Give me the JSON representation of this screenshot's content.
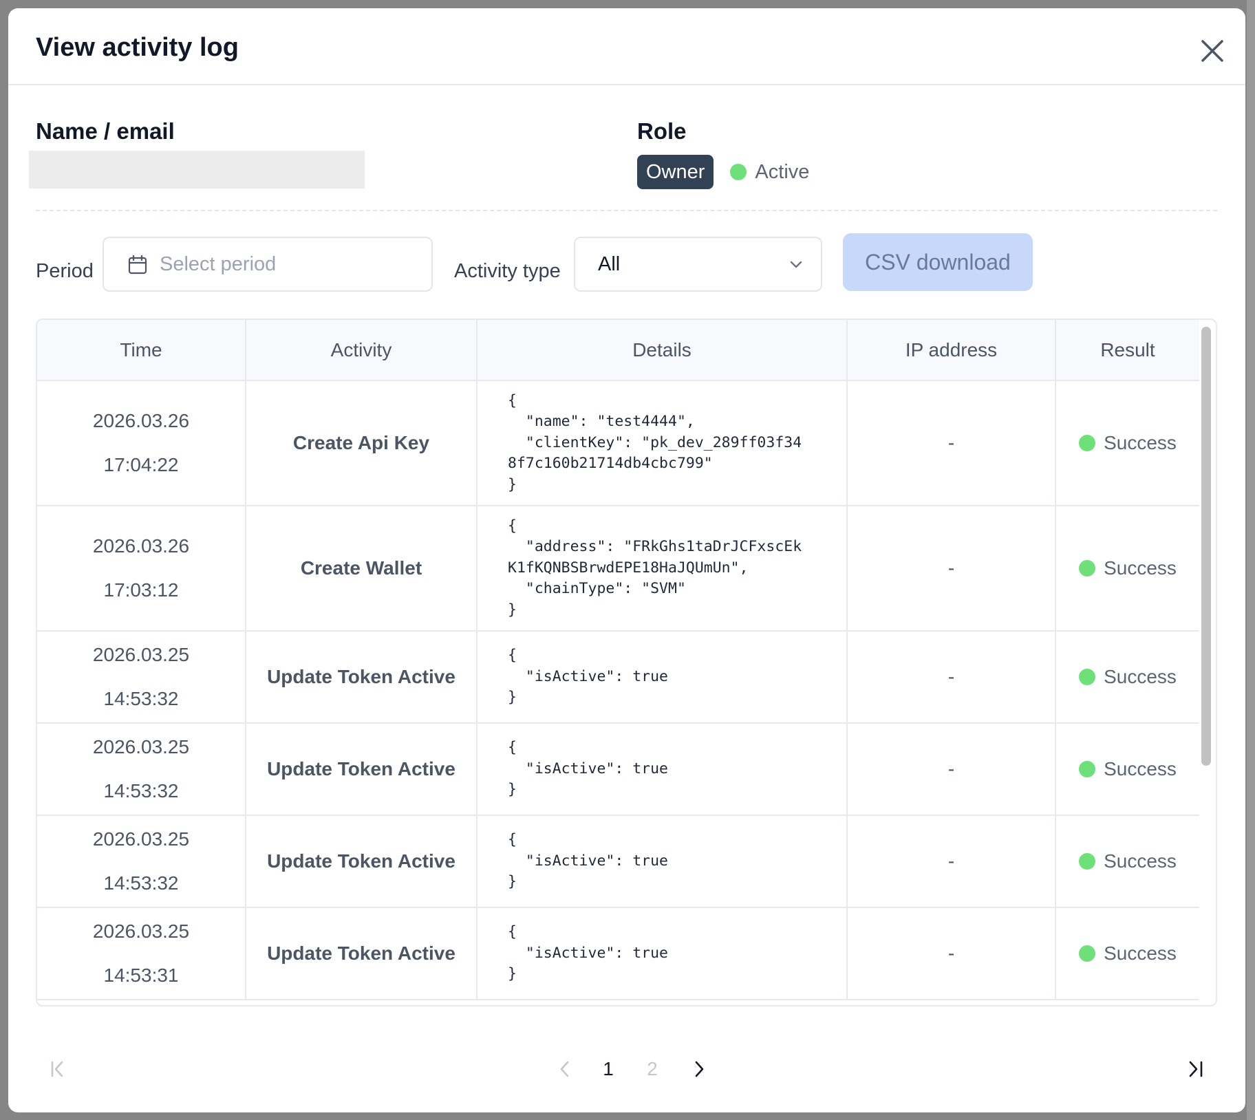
{
  "modal": {
    "title": "View activity log"
  },
  "user": {
    "name_label": "Name / email",
    "role_label": "Role",
    "role": "Owner",
    "status": "Active"
  },
  "filters": {
    "period_label": "Period",
    "period_placeholder": "Select period",
    "activity_type_label": "Activity type",
    "activity_type_value": "All",
    "csv_button": "CSV download"
  },
  "table": {
    "columns": [
      "Time",
      "Activity",
      "Details",
      "IP address",
      "Result"
    ],
    "rows": [
      {
        "date": "2026.03.26",
        "time": "17:04:22",
        "activity": "Create Api Key",
        "details": "{\n  \"name\": \"test4444\",\n  \"clientKey\": \"pk_dev_289ff03f34\n8f7c160b21714db4cbc799\"\n}",
        "ip": "-",
        "result": "Success"
      },
      {
        "date": "2026.03.26",
        "time": "17:03:12",
        "activity": "Create Wallet",
        "details": "{\n  \"address\": \"FRkGhs1taDrJCFxscEk\nK1fKQNBSBrwdEPE18HaJQUmUn\",\n  \"chainType\": \"SVM\"\n}",
        "ip": "-",
        "result": "Success"
      },
      {
        "date": "2026.03.25",
        "time": "14:53:32",
        "activity": "Update Token Active",
        "details": "{\n  \"isActive\": true\n}",
        "ip": "-",
        "result": "Success"
      },
      {
        "date": "2026.03.25",
        "time": "14:53:32",
        "activity": "Update Token Active",
        "details": "{\n  \"isActive\": true\n}",
        "ip": "-",
        "result": "Success"
      },
      {
        "date": "2026.03.25",
        "time": "14:53:32",
        "activity": "Update Token Active",
        "details": "{\n  \"isActive\": true\n}",
        "ip": "-",
        "result": "Success"
      },
      {
        "date": "2026.03.25",
        "time": "14:53:31",
        "activity": "Update Token Active",
        "details": "{\n  \"isActive\": true\n}",
        "ip": "-",
        "result": "Success"
      }
    ]
  },
  "pagination": {
    "pages": [
      "1",
      "2"
    ],
    "current_page": "1"
  },
  "colors": {
    "accent_button_bg": "#c7d8fb",
    "status_green": "#6ee07a",
    "owner_badge_bg": "#334155"
  },
  "icons": {
    "close": "close-icon",
    "calendar": "calendar-icon",
    "dropdown": "chevron-down-icon",
    "first_page": "first-page-icon",
    "prev_page": "chevron-left-icon",
    "next_page": "chevron-right-icon",
    "last_page": "last-page-icon"
  }
}
